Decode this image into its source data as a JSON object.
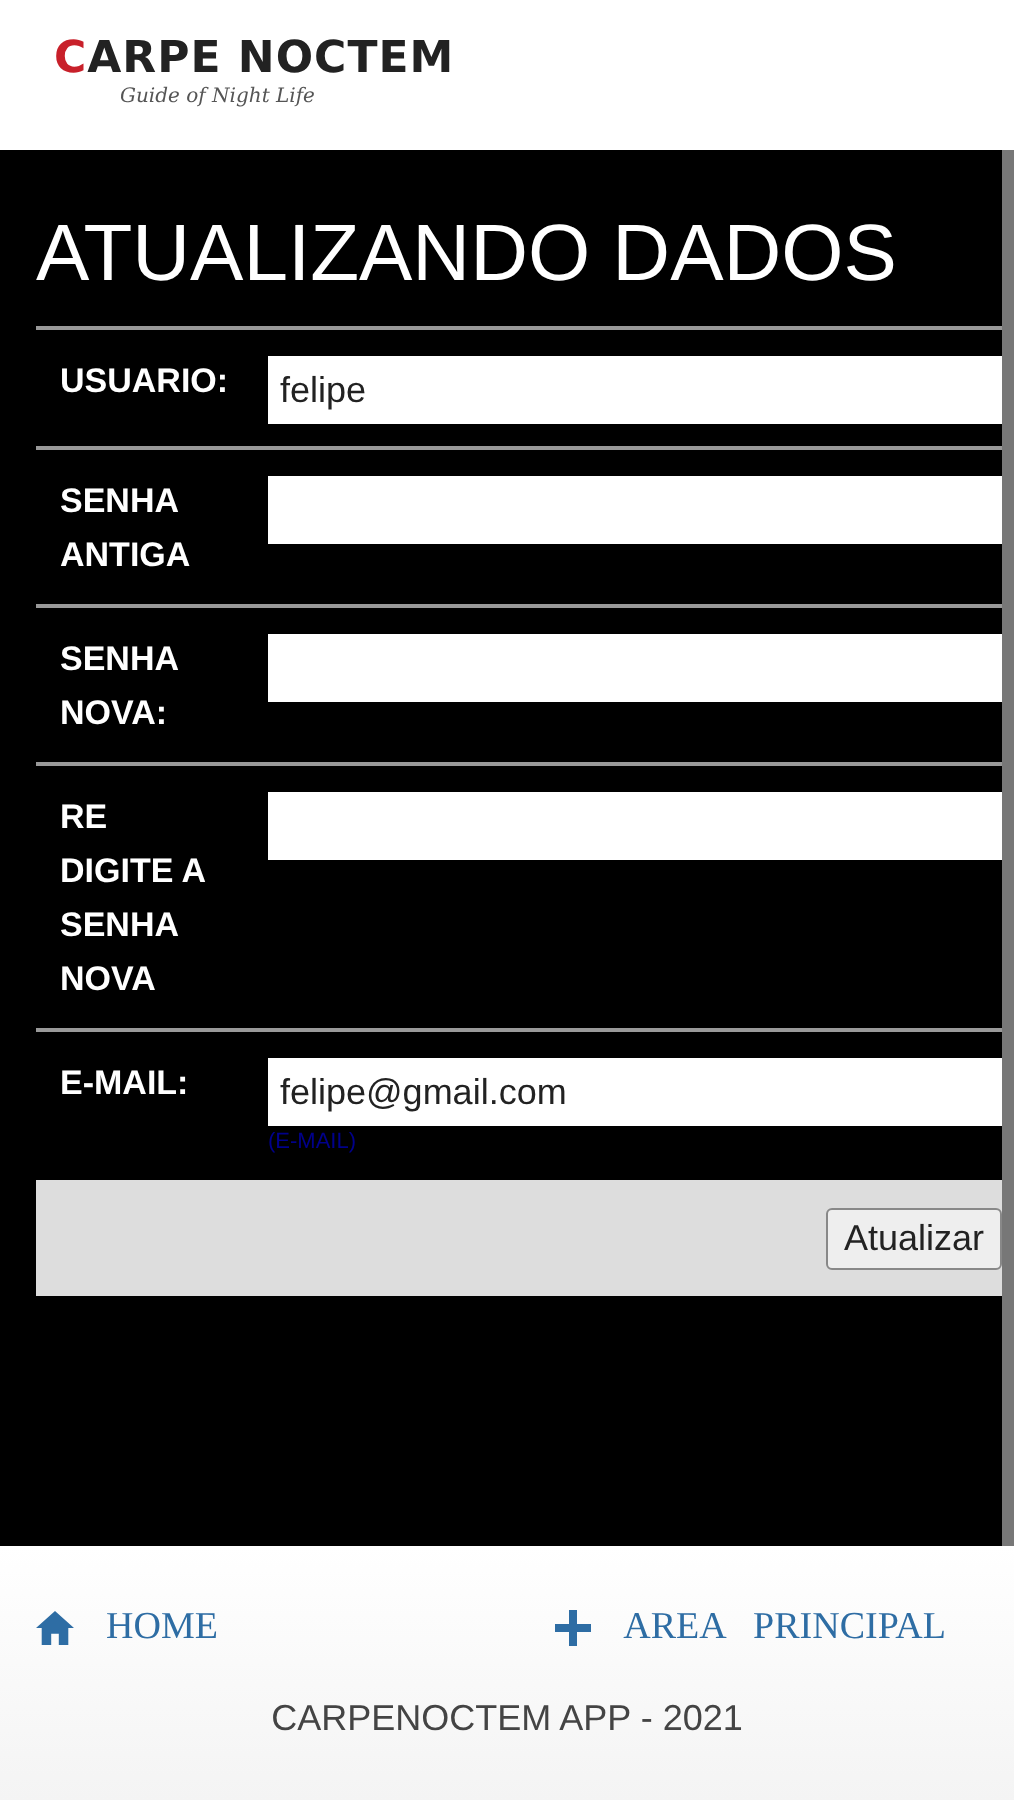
{
  "header": {
    "logo": {
      "accent": "C",
      "rest": "ARPE NOCTEM"
    },
    "tagline": "Guide of Night Life"
  },
  "form": {
    "title": "ATUALIZANDO DADOS",
    "fields": [
      {
        "label_lines": [
          "USUARIO:"
        ],
        "value": "felipe"
      },
      {
        "label_lines": [
          "SENHA",
          "ANTIGA"
        ]
      },
      {
        "label_lines": [
          "SENHA",
          "NOVA:"
        ]
      },
      {
        "label_lines": [
          "RE",
          "DIGITE A",
          "SENHA",
          "NOVA"
        ]
      },
      {
        "label_lines": [
          "E-MAIL:"
        ],
        "value": "felipe@gmail.com",
        "hint": "(E-MAIL)"
      }
    ],
    "submit": "Atualizar"
  },
  "nav": [
    {
      "kind": "home",
      "label": "HOME"
    },
    {
      "kind": "plus",
      "label": "AREA   PRINCIPAL"
    }
  ],
  "footer": "CARPENOCTEM APP - 2021"
}
